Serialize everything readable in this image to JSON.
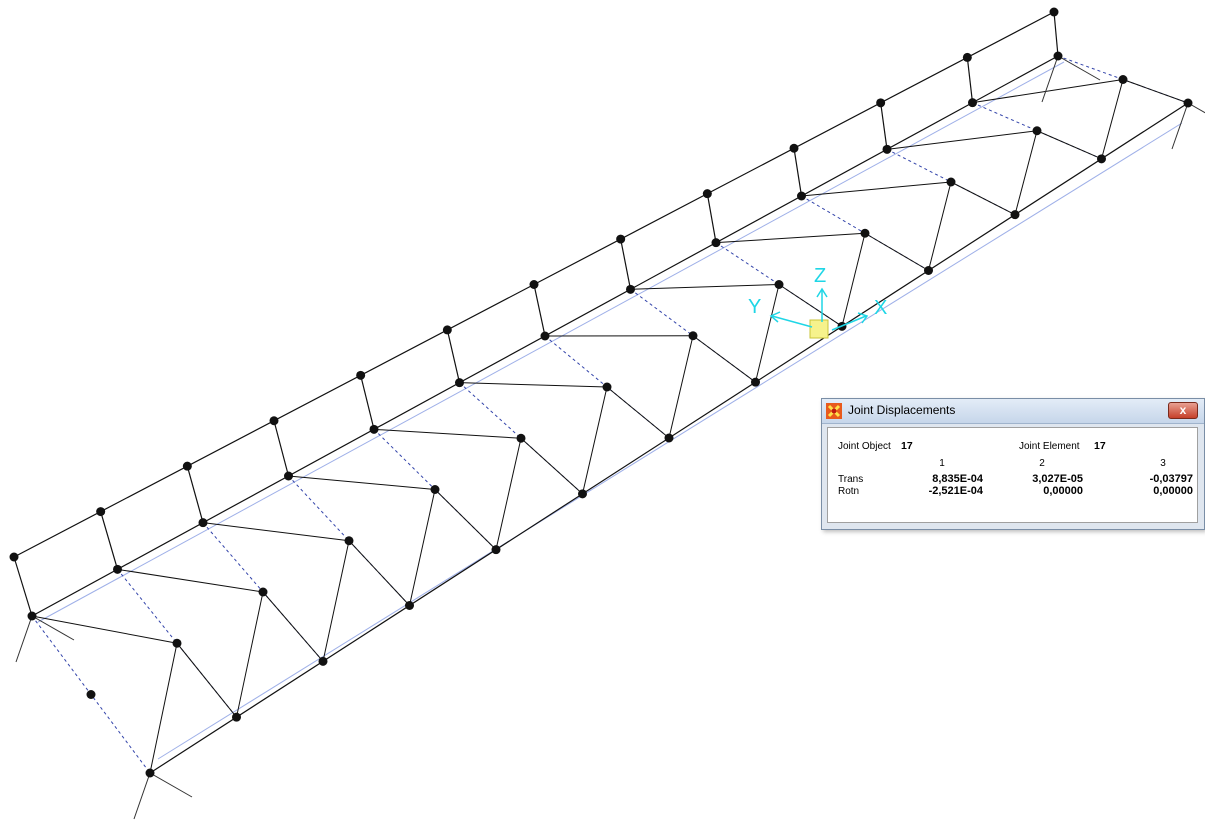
{
  "axes": {
    "x_label": "X",
    "y_label": "Y",
    "z_label": "Z"
  },
  "dialog": {
    "title": "Joint Displacements",
    "close_label": "x",
    "joint_object_label": "Joint Object",
    "joint_object_value": "17",
    "joint_element_label": "Joint Element",
    "joint_element_value": "17",
    "columns": [
      "1",
      "2",
      "3"
    ],
    "rows": [
      {
        "label": "Trans",
        "values": [
          "8,835E-04",
          "3,027E-05",
          "-0,03797"
        ]
      },
      {
        "label": "Rotn",
        "values": [
          "-2,521E-04",
          "0,00000",
          "0,00000"
        ]
      }
    ]
  },
  "colors": {
    "frame": "#111111",
    "node": "#111111",
    "guide": "#9fb0e8",
    "axis": "#1fd6e6",
    "dialog_bg": "#dfe6ef"
  }
}
